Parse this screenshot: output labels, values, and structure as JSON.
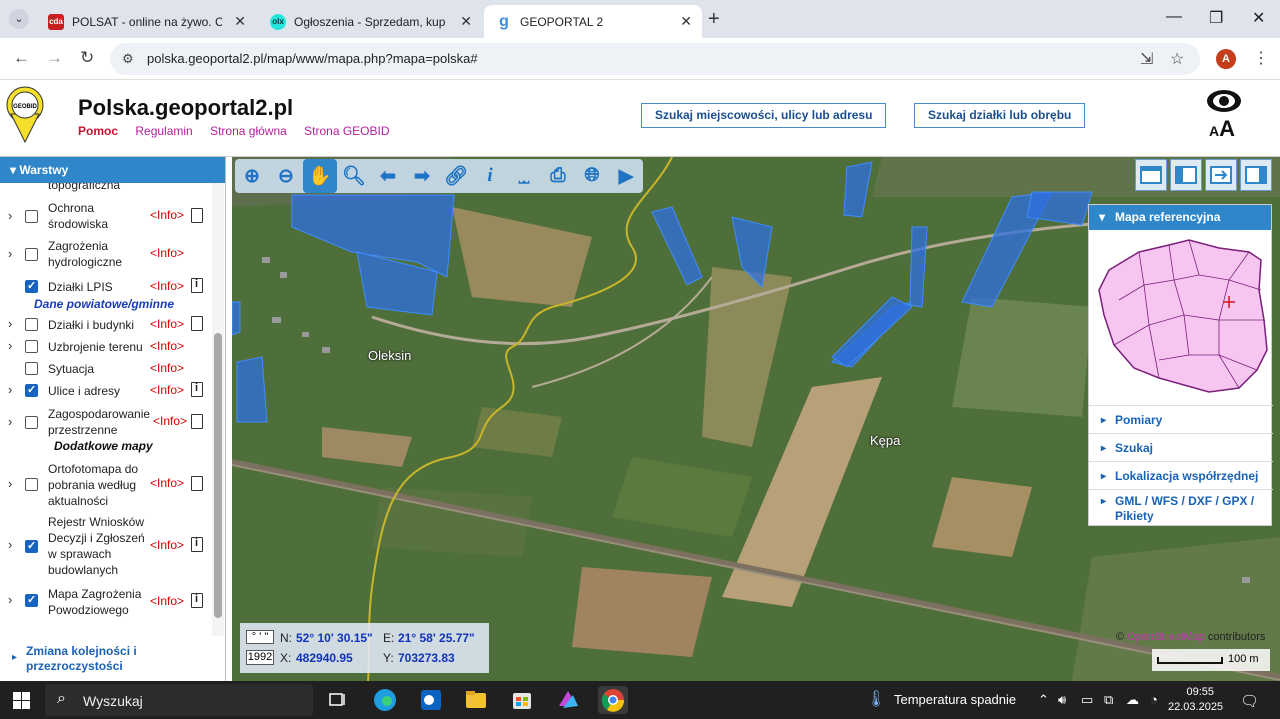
{
  "browser": {
    "tabs": [
      {
        "title": "POLSAT - online na żywo. CDA",
        "favicon": "cda-favicon",
        "active": false
      },
      {
        "title": "Ogłoszenia - Sprzedam, kupię",
        "favicon": "olx-favicon",
        "active": false
      },
      {
        "title": "GEOPORTAL 2",
        "favicon": "geoportal-favicon",
        "active": true
      }
    ],
    "url": "polska.geoportal2.pl/map/www/mapa.php?mapa=polska#",
    "profile_initial": "A"
  },
  "header": {
    "logo_text": "GEOBID",
    "title": "Polska.geoportal2.pl",
    "links": [
      "Pomoc",
      "Regulamin",
      "Strona główna",
      "Strona GEOBID"
    ],
    "search_address_label": "Szukaj miejscowości, ulicy lub adresu",
    "search_parcel_label": "Szukaj działki lub obrębu"
  },
  "layers_panel": {
    "title": "Warstwy",
    "partial_top": "topograficzna",
    "info_label": "<Info>",
    "items": [
      {
        "name": "Ochrona środowiska",
        "checked": false,
        "doc": "doc"
      },
      {
        "name": "Zagrożenia hydrologiczne",
        "checked": false,
        "doc": ""
      },
      {
        "name": "Działki LPIS",
        "checked": true,
        "doc": "doc-info"
      },
      {
        "name": "Działki i budynki",
        "checked": false,
        "doc": "doc"
      },
      {
        "name": "Uzbrojenie terenu",
        "checked": false,
        "doc": ""
      },
      {
        "name": "Sytuacja",
        "checked": false,
        "doc": ""
      },
      {
        "name": "Ulice i adresy",
        "checked": true,
        "doc": "doc-info"
      },
      {
        "name": "Zagospodarowanie przestrzenne",
        "checked": false,
        "doc": "doc"
      },
      {
        "name": "Ortofotomapa do pobrania według aktualności",
        "checked": false,
        "doc": "doc"
      },
      {
        "name": "Rejestr Wniosków Decyzji i Zgłoszeń w sprawach budowlanych",
        "checked": true,
        "doc": "doc-info"
      },
      {
        "name": "Mapa Zagrożenia Powodziowego",
        "checked": true,
        "doc": "doc-info"
      }
    ],
    "sections": [
      "Dane powiatowe/gminne",
      "Dodatkowe mapy"
    ],
    "order_link": "Zmiana kolejności i przezroczystości"
  },
  "map": {
    "place_labels": [
      "Oleksin",
      "Kępa"
    ],
    "reference_panel": {
      "title": "Mapa referencyjna",
      "items": [
        "Pomiary",
        "Szukaj",
        "Lokalizacja współrzędnej",
        "GML / WFS / DXF / GPX / Pikiety"
      ]
    },
    "coords": {
      "format_label": "° ' \"",
      "system_label": "1992",
      "n_label": "N:",
      "n_value": "52° 10' 30.15\"",
      "e_label": "E:",
      "e_value": "21° 58' 25.77\"",
      "x_label": "X:",
      "x_value": "482940.95",
      "y_label": "Y:",
      "y_value": "703273.83"
    },
    "attribution_prefix": "©",
    "attribution_link": "OpenStreetMap",
    "attribution_suffix": "contributors",
    "scale_label": "100 m",
    "colors": {
      "parcel_fill": "#2f6fe0",
      "river": "#c8b52a",
      "panel_blue": "#2f86c9"
    }
  },
  "taskbar": {
    "search_placeholder": "Wyszukaj",
    "weather": "Temperatura spadnie",
    "time": "09:55",
    "date": "22.03.2025"
  }
}
